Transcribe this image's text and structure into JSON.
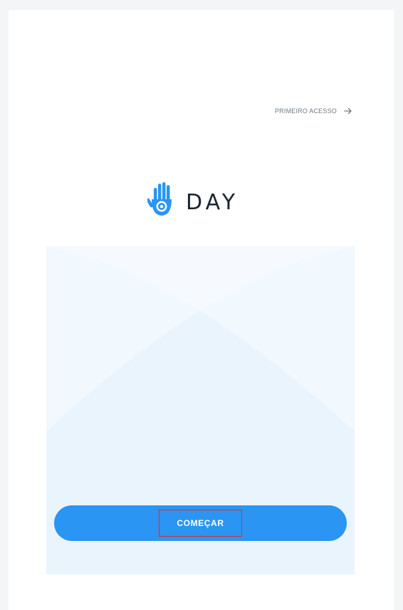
{
  "header": {
    "first_access_label": "PRIMEIRO ACESSO"
  },
  "logo": {
    "wordmark": "DAY",
    "icon": "hand-icon"
  },
  "actions": {
    "start_label": "COMEÇAR"
  },
  "colors": {
    "accent": "#2a95f2",
    "panel": "#eaf4fd",
    "text_dark": "#1a2433",
    "text_muted": "#6c7a86",
    "highlight_border": "#d9312c"
  }
}
